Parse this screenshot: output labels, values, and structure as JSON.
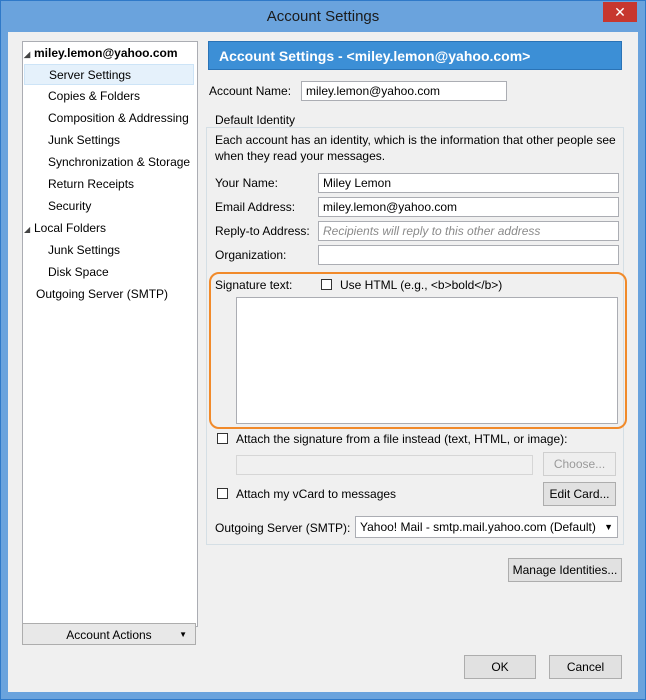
{
  "window": {
    "title": "Account Settings",
    "close_glyph": "✕"
  },
  "sidebar": {
    "items": [
      {
        "label": "miley.lemon@yahoo.com",
        "level": 0,
        "expanded": true,
        "selected": false
      },
      {
        "label": "Server Settings",
        "level": 1,
        "selected": true
      },
      {
        "label": "Copies & Folders",
        "level": 1
      },
      {
        "label": "Composition & Addressing",
        "level": 1
      },
      {
        "label": "Junk Settings",
        "level": 1
      },
      {
        "label": "Synchronization & Storage",
        "level": 1
      },
      {
        "label": "Return Receipts",
        "level": 1
      },
      {
        "label": "Security",
        "level": 1
      },
      {
        "label": "Local Folders",
        "level": 0,
        "expanded": true
      },
      {
        "label": "Junk Settings",
        "level": 1
      },
      {
        "label": "Disk Space",
        "level": 1
      },
      {
        "label": "Outgoing Server (SMTP)",
        "level": 0
      }
    ],
    "account_actions": "Account Actions"
  },
  "main": {
    "header": "Account Settings - <miley.lemon@yahoo.com>",
    "account_name": {
      "label": "Account Name:",
      "value": "miley.lemon@yahoo.com"
    },
    "identity": {
      "title": "Default Identity",
      "description": "Each account has an identity, which is the information that other people see when they read your messages.",
      "your_name": {
        "label": "Your Name:",
        "value": "Miley Lemon"
      },
      "email": {
        "label": "Email Address:",
        "value": "miley.lemon@yahoo.com"
      },
      "reply_to": {
        "label": "Reply-to Address:",
        "placeholder": "Recipients will reply to this other address"
      },
      "organization": {
        "label": "Organization:",
        "value": ""
      },
      "signature_label": "Signature text:",
      "use_html": "Use HTML (e.g., <b>bold</b>)",
      "attach_file": "Attach the signature from a file instead (text, HTML, or image):",
      "choose": "Choose...",
      "attach_vcard": "Attach my vCard to messages",
      "edit_card": "Edit Card...",
      "outgoing_label": "Outgoing Server (SMTP):",
      "outgoing_value": "Yahoo! Mail - smtp.mail.yahoo.com (Default)"
    },
    "manage_identities": "Manage Identities...",
    "ok": "OK",
    "cancel": "Cancel"
  },
  "colors": {
    "header_bg": "#3c8fd6",
    "highlight": "#f18a2a",
    "frame": "#6aa3dd"
  }
}
